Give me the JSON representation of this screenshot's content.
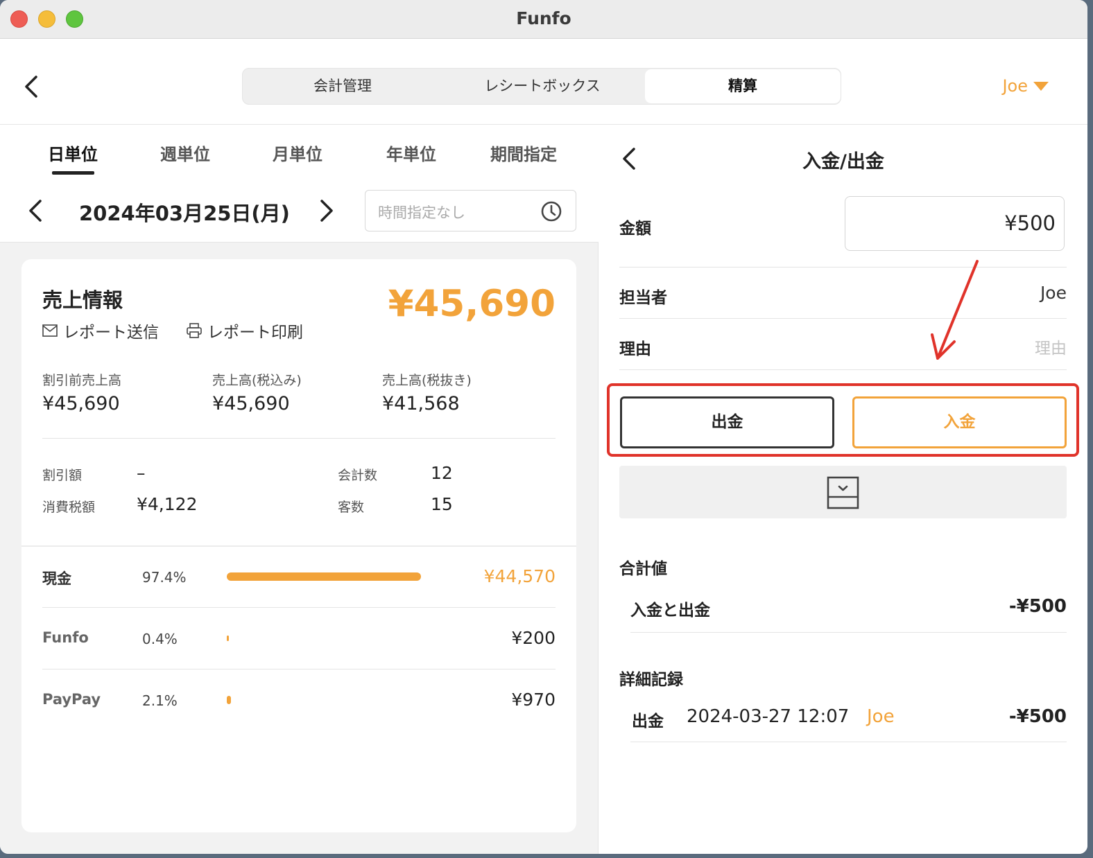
{
  "window": {
    "title": "Funfo"
  },
  "header": {
    "segments": [
      "会計管理",
      "レシートボックス",
      "精算"
    ],
    "active_segment": "精算",
    "user": "Joe"
  },
  "period_tabs": [
    "日単位",
    "週単位",
    "月単位",
    "年単位",
    "期間指定"
  ],
  "active_period": "日単位",
  "date": {
    "label": "2024年03月25日(月)",
    "time_placeholder": "時間指定なし"
  },
  "sales": {
    "title": "売上情報",
    "total": "¥45,690",
    "report_send": "レポート送信",
    "report_print": "レポート印刷",
    "stats": [
      {
        "label": "割引前売上高",
        "value": "¥45,690"
      },
      {
        "label": "売上高(税込み)",
        "value": "¥45,690"
      },
      {
        "label": "売上高(税抜き)",
        "value": "¥41,568"
      }
    ],
    "mini": {
      "discount_label": "割引額",
      "discount_value": "–",
      "tax_label": "消費税額",
      "tax_value": "¥4,122",
      "count_label": "会計数",
      "count_value": "12",
      "customers_label": "客数",
      "customers_value": "15"
    },
    "payments": [
      {
        "name": "現金",
        "pct": "97.4%",
        "share": 97.4,
        "amount": "¥44,570"
      },
      {
        "name": "Funfo",
        "pct": "0.4%",
        "share": 0.4,
        "amount": "¥200"
      },
      {
        "name": "PayPay",
        "pct": "2.1%",
        "share": 2.1,
        "amount": "¥970"
      }
    ]
  },
  "cash": {
    "title": "入金/出金",
    "amount_label": "金額",
    "amount_value": "¥500",
    "staff_label": "担当者",
    "staff_value": "Joe",
    "reason_label": "理由",
    "reason_placeholder": "理由",
    "withdraw_label": "出金",
    "deposit_label": "入金",
    "total_section": "合計値",
    "total_label": "入金と出金",
    "total_value": "-¥500",
    "detail_section": "詳細記録",
    "record": {
      "type": "出金",
      "datetime": "2024-03-27 12:07",
      "user": "Joe",
      "amount": "-¥500"
    }
  },
  "colors": {
    "accent": "#f2a33a",
    "highlight": "#e0332a"
  }
}
